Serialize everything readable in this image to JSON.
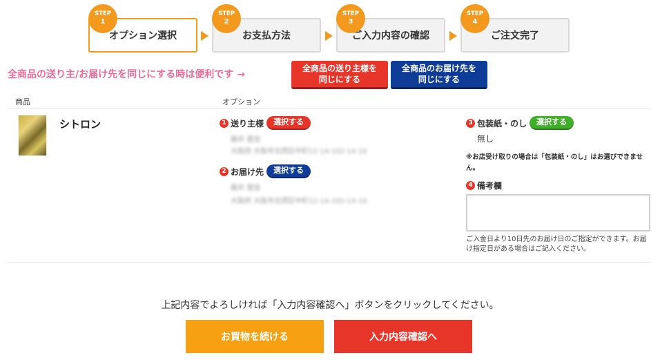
{
  "steps": [
    {
      "badge": "STEP",
      "num": "1",
      "label": "オプション選択",
      "active": true
    },
    {
      "badge": "STEP",
      "num": "2",
      "label": "お支払方法",
      "active": false
    },
    {
      "badge": "STEP",
      "num": "3",
      "label": "ご入力内容の確認",
      "active": false
    },
    {
      "badge": "STEP",
      "num": "4",
      "label": "ご注文完了",
      "active": false
    }
  ],
  "same_for_all": {
    "text": "全商品の送り主/お届け先を同じにする時は便利です →",
    "sender_button": "全商品の送り主様を\n同じにする",
    "recipient_button": "全商品のお届け先を\n同じにする"
  },
  "table": {
    "col_product": "商品",
    "col_option": "オプション"
  },
  "item": {
    "name": "シトロン",
    "sender": {
      "num": "1",
      "label": "送り主様",
      "select": "選択する",
      "name_blurred": "藤井 里佳",
      "address_blurred": "大阪府 大阪市北摂区中町12-14-102-14-10"
    },
    "recipient": {
      "num": "2",
      "label": "お届け先",
      "select": "選択する",
      "name_blurred": "藤井 里佳",
      "address_blurred": "大阪府 大阪市北摂区中町12-14-102-14-10"
    },
    "wrapping": {
      "num": "3",
      "label": "包装紙・のし",
      "select": "選択する",
      "value": "無し"
    },
    "wrapping_note": "※お店受け取りの場合は「包装紙・のし」はお選びできません。",
    "remarks": {
      "num": "4",
      "label": "備考欄",
      "value": ""
    },
    "delivery_note": "ご入金日より10日先のお届け日のご指定ができます。お届け指定日がある場合はご記入ください。"
  },
  "footer": {
    "message": "上記内容でよろしければ「入力内容確認へ」ボタンをクリックしてください。",
    "continue_button": "お買物を続ける",
    "confirm_button": "入力内容確認へ"
  },
  "colors": {
    "accent_orange": "#f39a1e",
    "red": "#e8352a",
    "blue": "#0f3c97",
    "green": "#3fae29",
    "pink_text": "#ee6b98"
  }
}
